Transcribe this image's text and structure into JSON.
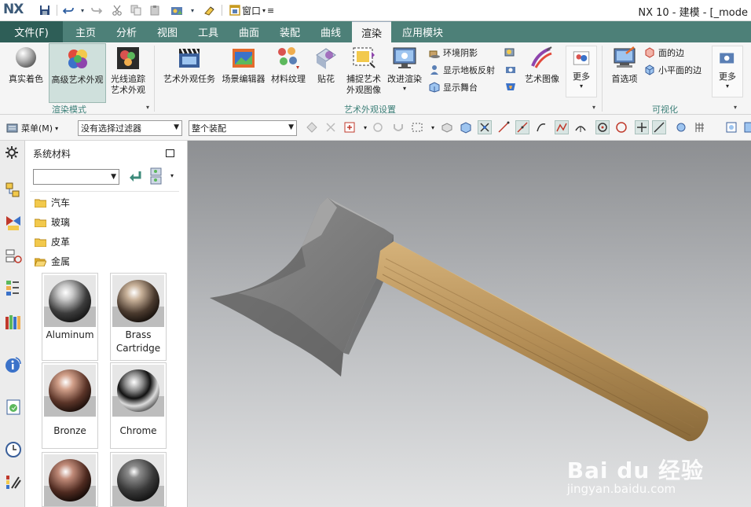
{
  "app": {
    "logo": "NX",
    "window_title": "NX 10 - 建模 - [_mode"
  },
  "quick_access": {
    "window_menu": "窗口"
  },
  "tabs": [
    {
      "label": "文件(F)"
    },
    {
      "label": "主页"
    },
    {
      "label": "分析"
    },
    {
      "label": "视图"
    },
    {
      "label": "工具"
    },
    {
      "label": "曲面"
    },
    {
      "label": "装配"
    },
    {
      "label": "曲线"
    },
    {
      "label": "渲染"
    },
    {
      "label": "应用模块"
    }
  ],
  "active_tab": "渲染",
  "ribbon": {
    "render_mode": {
      "group_label": "渲染模式",
      "buttons": [
        {
          "label": "真实着色"
        },
        {
          "label": "高级艺术外观"
        },
        {
          "label": "光线追踪\n艺术外观"
        }
      ]
    },
    "art_settings": {
      "group_label": "艺术外观设置",
      "buttons": [
        {
          "label": "艺术外观任务"
        },
        {
          "label": "场景编辑器"
        },
        {
          "label": "材料纹理"
        },
        {
          "label": "贴花"
        },
        {
          "label": "捕捉艺术\n外观图像"
        },
        {
          "label": "改进渲染"
        },
        {
          "label": "艺术图像"
        },
        {
          "label": "更多"
        }
      ],
      "small": [
        {
          "label": "环境阴影"
        },
        {
          "label": "显示地板反射"
        },
        {
          "label": "显示舞台"
        }
      ]
    },
    "visualization": {
      "group_label": "可视化",
      "buttons": [
        {
          "label": "首选项"
        },
        {
          "label": "更多"
        }
      ],
      "small": [
        {
          "label": "面的边"
        },
        {
          "label": "小平面的边"
        }
      ]
    }
  },
  "toolbar": {
    "menu_label": "菜单(M)",
    "filter_value": "没有选择过滤器",
    "assembly_value": "整个装配"
  },
  "panel": {
    "title": "系统材料",
    "folders": [
      {
        "label": "汽车"
      },
      {
        "label": "玻璃"
      },
      {
        "label": "皮革"
      },
      {
        "label": "金属"
      }
    ],
    "materials": [
      {
        "name": "Aluminum"
      },
      {
        "name": "Brass\nCartridge"
      },
      {
        "name": "Bronze"
      },
      {
        "name": "Chrome"
      }
    ]
  },
  "watermark": {
    "brand": "Bai du 经验",
    "url": "jingyan.baidu.com"
  },
  "colors": {
    "tab_bar": "#4d8078",
    "file_tab": "#2e5e57",
    "group_label": "#3c7f78",
    "axe_head": "#7a7a7a",
    "handle": "#b8955c"
  }
}
